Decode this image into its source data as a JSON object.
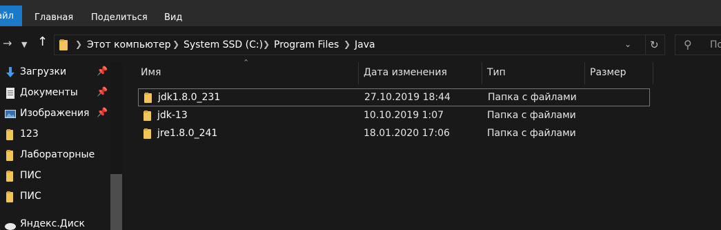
{
  "ribbon": {
    "file_tab": "Файл",
    "tabs": [
      "Главная",
      "Поделиться",
      "Вид"
    ]
  },
  "nav": {
    "back_icon": "arrow-left-icon",
    "forward_icon": "arrow-right-icon",
    "recent_icon": "chevron-down-icon",
    "up_icon": "arrow-up-icon"
  },
  "address": {
    "crumbs": [
      "Этот компьютер",
      "System SSD (C:)",
      "Program Files",
      "Java"
    ]
  },
  "search": {
    "placeholder": "По"
  },
  "sidebar": {
    "items": [
      {
        "label": "Загрузки",
        "icon": "download-icon",
        "pinned": true
      },
      {
        "label": "Документы",
        "icon": "documents-icon",
        "pinned": true
      },
      {
        "label": "Изображения",
        "icon": "pictures-icon",
        "pinned": true
      },
      {
        "label": "123",
        "icon": "folder-icon",
        "pinned": false
      },
      {
        "label": "Лабораторные",
        "icon": "folder-icon",
        "pinned": false
      },
      {
        "label": "ПИС",
        "icon": "folder-icon",
        "pinned": false
      },
      {
        "label": "ПИС",
        "icon": "folder-icon",
        "pinned": false
      },
      {
        "label": "Яндекс.Диск",
        "icon": "yandex-disk-icon",
        "pinned": false
      }
    ]
  },
  "columns": {
    "name": "Имя",
    "date": "Дата изменения",
    "type": "Тип",
    "size": "Размер"
  },
  "files": [
    {
      "name": "jdk1.8.0_231",
      "date": "27.10.2019 18:44",
      "type": "Папка с файлами",
      "selected": true
    },
    {
      "name": "jdk-13",
      "date": "10.10.2019 1:07",
      "type": "Папка с файлами",
      "selected": false
    },
    {
      "name": "jre1.8.0_241",
      "date": "18.01.2020 17:06",
      "type": "Папка с файлами",
      "selected": false
    }
  ],
  "colors": {
    "folder": "#f2c55c",
    "accent": "#1979ca",
    "download": "#3c9ef0"
  }
}
